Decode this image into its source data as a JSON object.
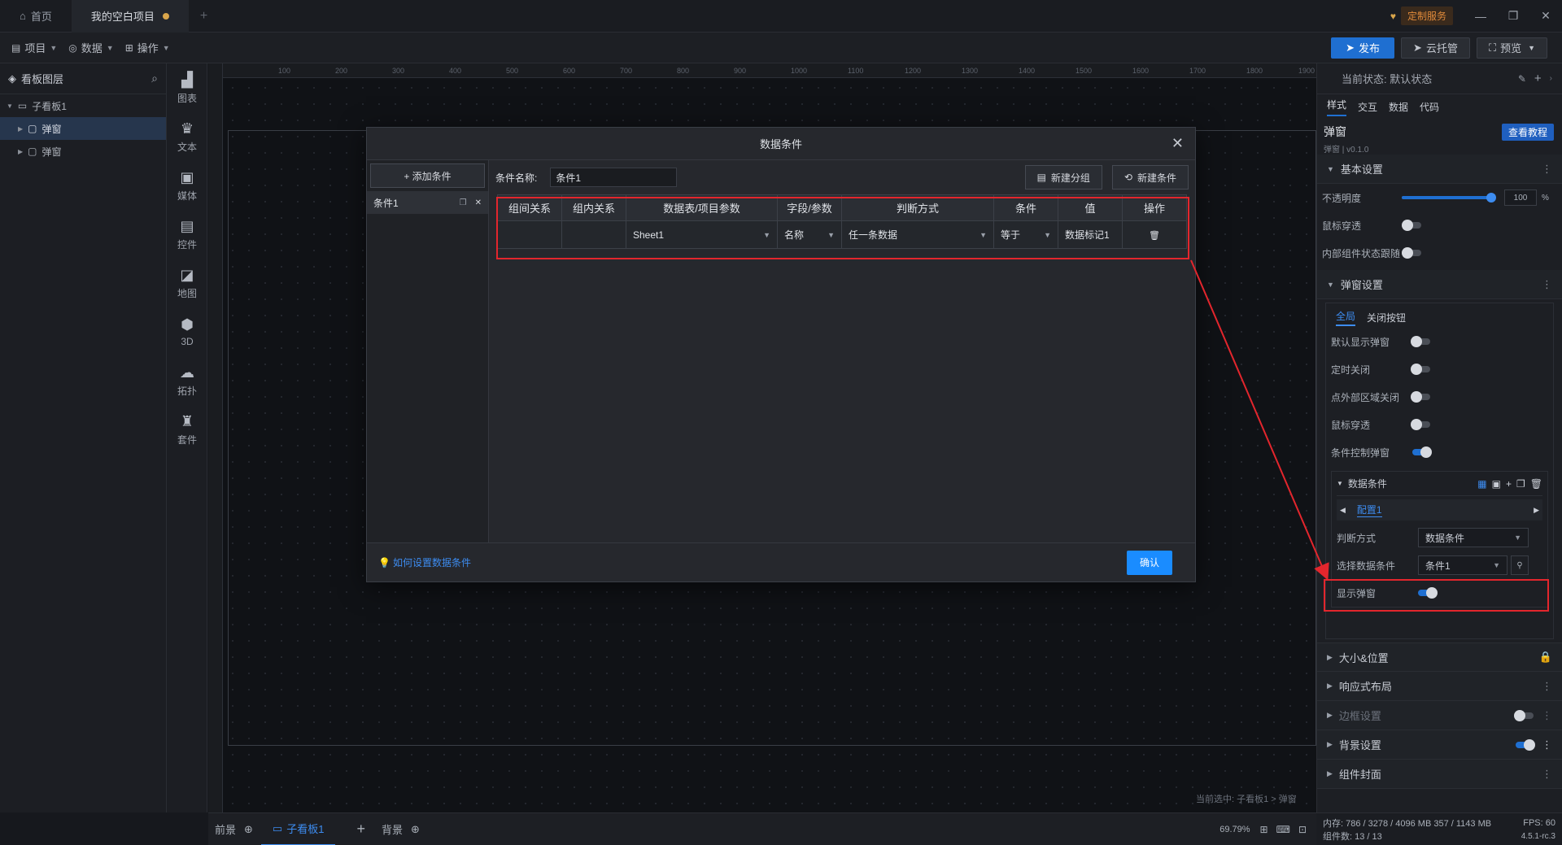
{
  "titlebar": {
    "home_tab": "首页",
    "project_tab": "我的空白项目",
    "service_badge": "定制服务"
  },
  "toolbar": {
    "project": "项目",
    "data": "数据",
    "operate": "操作",
    "publish": "发布",
    "cloud_host": "云托管",
    "preview": "预览"
  },
  "layers": {
    "title": "看板图层",
    "items": [
      {
        "label": "子看板1"
      },
      {
        "label": "弹窗"
      },
      {
        "label": "弹窗"
      }
    ]
  },
  "icon_column": [
    {
      "icon": "chart-icon",
      "label": "图表"
    },
    {
      "icon": "text-icon",
      "label": "文本"
    },
    {
      "icon": "media-icon",
      "label": "媒体"
    },
    {
      "icon": "control-icon",
      "label": "控件"
    },
    {
      "icon": "map-icon",
      "label": "地图"
    },
    {
      "icon": "cube-icon",
      "label": "3D"
    },
    {
      "icon": "topology-icon",
      "label": "拓扑"
    },
    {
      "icon": "suite-icon",
      "label": "套件"
    }
  ],
  "ruler_ticks": [
    "100",
    "200",
    "300",
    "400",
    "500",
    "600",
    "700",
    "800",
    "900",
    "1000",
    "1100",
    "1200",
    "1300",
    "1400",
    "1500",
    "1600",
    "1700",
    "1800",
    "1900"
  ],
  "canvas": {
    "current_selection": "当前选中: 子看板1 > 弹窗"
  },
  "bottombar": {
    "foreground": "前景",
    "child_board": "子看板1",
    "background": "背景",
    "zoom": "69.79%"
  },
  "modal": {
    "title": "数据条件",
    "add_condition": "+ 添加条件",
    "condition_item": "条件1",
    "name_label": "条件名称:",
    "name_value": "条件1",
    "new_group": "新建分组",
    "new_condition": "新建条件",
    "columns": [
      "组间关系",
      "组内关系",
      "数据表/项目参数",
      "字段/参数",
      "判断方式",
      "条件",
      "值",
      "操作"
    ],
    "row": {
      "table": "Sheet1",
      "field": "名称",
      "judge": "任一条数据",
      "cond": "等于",
      "value": "数据标记1"
    },
    "help_link": "如何设置数据条件",
    "confirm": "确认"
  },
  "rightpanel": {
    "current_state": "当前状态: 默认状态",
    "tabs": [
      "样式",
      "交互",
      "数据",
      "代码"
    ],
    "component_name": "弹窗",
    "component_version": "弹窗 | v0.1.0",
    "tutorial": "查看教程",
    "basic": {
      "title": "基本设置",
      "opacity_label": "不透明度",
      "opacity_value": "100",
      "opacity_unit": "%",
      "opacity_level": 1.0,
      "mouse_pass": "鼠标穿透",
      "inner_follow": "内部组件状态跟随"
    },
    "popup": {
      "title": "弹窗设置",
      "subtabs": [
        "全局",
        "关闭按钮"
      ],
      "default_show": "默认显示弹窗",
      "timed_close": "定时关闭",
      "outside_close": "点外部区域关闭",
      "mouse_pass": "鼠标穿透",
      "cond_control": "条件控制弹窗",
      "data_cond_title": "数据条件",
      "config_tab": "配置1",
      "judge_label": "判断方式",
      "judge_value": "数据条件",
      "select_label": "选择数据条件",
      "select_value": "条件1",
      "show_popup": "显示弹窗"
    },
    "sections": [
      "大小&位置",
      "响应式布局",
      "边框设置",
      "背景设置",
      "组件封面"
    ]
  },
  "statusbar": {
    "memory": "内存: 786 / 3278 / 4096 MB  357 / 1143 MB",
    "fps": "FPS: 60",
    "components": "组件数: 13 / 13",
    "version": "4.5.1-rc.3"
  },
  "colors": {
    "accent": "#1f6fd1",
    "highlight": "#e3262d",
    "confirm": "#1a8cff"
  }
}
